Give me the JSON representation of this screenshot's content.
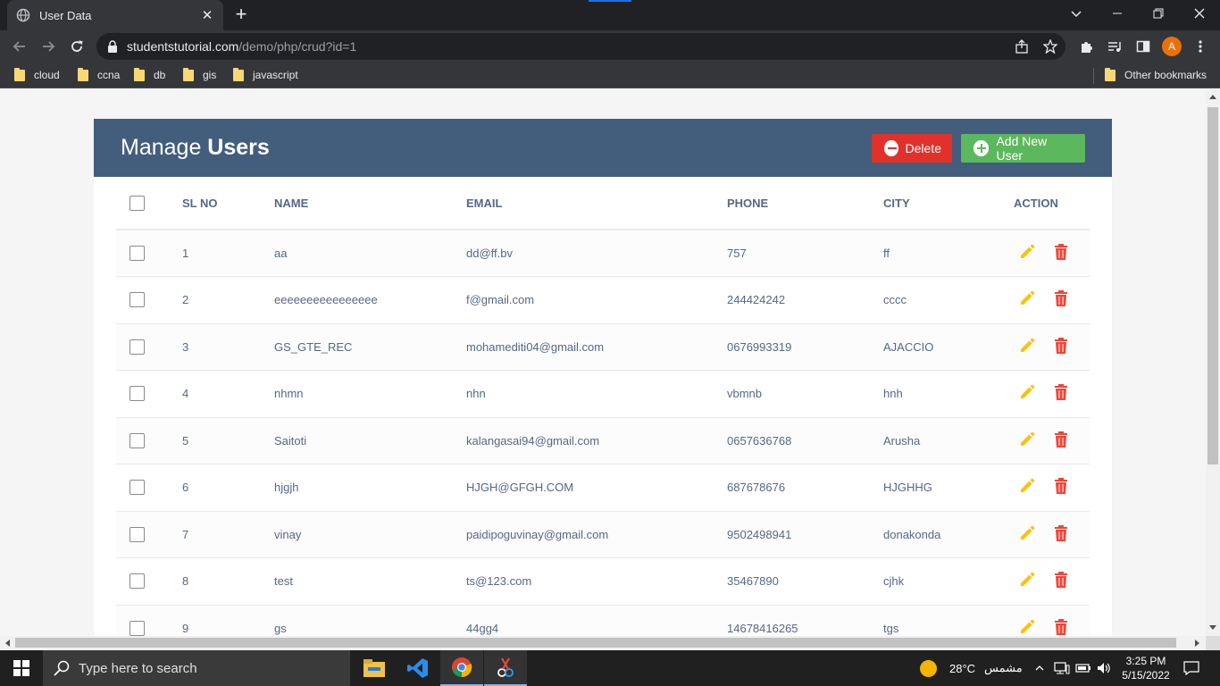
{
  "browser": {
    "tab_title": "User Data",
    "url_host": "studentstutorial.com",
    "url_path": "/demo/php/crud?id=1",
    "profile_initial": "A",
    "bookmarks": [
      "cloud",
      "ccna",
      "db",
      "gis",
      "javascript"
    ],
    "other_bookmarks": "Other bookmarks"
  },
  "header": {
    "title_light": "Manage ",
    "title_bold": "Users",
    "delete_label": "Delete",
    "add_label": "Add New User"
  },
  "table": {
    "columns": [
      "SL NO",
      "NAME",
      "EMAIL",
      "PHONE",
      "CITY",
      "ACTION"
    ],
    "rows": [
      {
        "sl": "1",
        "name": "aa",
        "email": "dd@ff.bv",
        "phone": "757",
        "city": "ff"
      },
      {
        "sl": "2",
        "name": "eeeeeeeeeeeeeeee",
        "email": "f@gmail.com",
        "phone": "244424242",
        "city": "cccc"
      },
      {
        "sl": "3",
        "name": "GS_GTE_REC",
        "email": "mohamediti04@gmail.com",
        "phone": "0676993319",
        "city": "AJACCIO"
      },
      {
        "sl": "4",
        "name": "nhmn",
        "email": "nhn",
        "phone": "vbmnb",
        "city": "hnh"
      },
      {
        "sl": "5",
        "name": "Saitoti",
        "email": "kalangasai94@gmail.com",
        "phone": "0657636768",
        "city": "Arusha"
      },
      {
        "sl": "6",
        "name": "hjgjh",
        "email": "HJGH@GFGH.COM",
        "phone": "687678676",
        "city": "HJGHHG"
      },
      {
        "sl": "7",
        "name": "vinay",
        "email": "paidipoguvinay@gmail.com",
        "phone": "9502498941",
        "city": "donakonda"
      },
      {
        "sl": "8",
        "name": "test",
        "email": "ts@123.com",
        "phone": "35467890",
        "city": "cjhk"
      },
      {
        "sl": "9",
        "name": "gs",
        "email": "44gg4",
        "phone": "14678416265",
        "city": "tgs"
      }
    ]
  },
  "taskbar": {
    "search_placeholder": "Type here to search",
    "weather_temp": "28°C",
    "weather_text": "مشمس",
    "time": "3:25 PM",
    "date": "5/15/2022"
  },
  "colors": {
    "header_bg": "#435d7d",
    "delete": "#e2302b",
    "add": "#5cb85c",
    "edit_icon": "#ffc107",
    "delete_icon": "#f44336"
  }
}
